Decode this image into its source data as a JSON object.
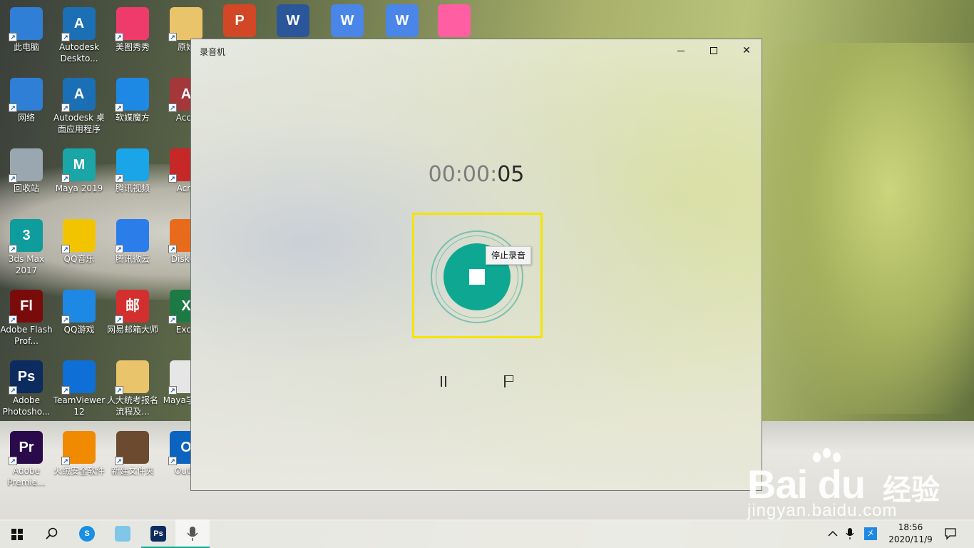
{
  "desktop": {
    "icons": [
      {
        "label": "此电脑",
        "glyph": "",
        "color": "#2f7fd6"
      },
      {
        "label": "Autodesk Deskto...",
        "glyph": "A",
        "color": "#1b6fb5"
      },
      {
        "label": "美图秀秀",
        "glyph": "",
        "color": "#ef3b6b"
      },
      {
        "label": "原始",
        "glyph": "",
        "color": "#e9c46a"
      },
      {
        "label": "网络",
        "glyph": "",
        "color": "#2f7fd6"
      },
      {
        "label": "Autodesk 桌面应用程序",
        "glyph": "A",
        "color": "#1b6fb5"
      },
      {
        "label": "软媒魔方",
        "glyph": "",
        "color": "#1e88e5"
      },
      {
        "label": "Acce",
        "glyph": "A",
        "color": "#a4373a"
      },
      {
        "label": "回收站",
        "glyph": "",
        "color": "#9aa7b0"
      },
      {
        "label": "Maya 2019",
        "glyph": "M",
        "color": "#1aa6a6"
      },
      {
        "label": "腾讯视频",
        "glyph": "",
        "color": "#1aa5e8"
      },
      {
        "label": "Acro",
        "glyph": "",
        "color": "#c62828"
      },
      {
        "label": "3ds Max 2017",
        "glyph": "3",
        "color": "#0f9c9c"
      },
      {
        "label": "QQ音乐",
        "glyph": "",
        "color": "#f2c400"
      },
      {
        "label": "腾讯微云",
        "glyph": "",
        "color": "#2b7de9"
      },
      {
        "label": "DiskGe",
        "glyph": "",
        "color": "#e86b1c"
      },
      {
        "label": "Adobe Flash Prof...",
        "glyph": "Fl",
        "color": "#7a0b0b"
      },
      {
        "label": "QQ游戏",
        "glyph": "",
        "color": "#1e88e5"
      },
      {
        "label": "网易邮箱大师",
        "glyph": "邮",
        "color": "#d32f2f"
      },
      {
        "label": "Exce",
        "glyph": "X",
        "color": "#1d7a45"
      },
      {
        "label": "Adobe Photosho...",
        "glyph": "Ps",
        "color": "#0c2b5e"
      },
      {
        "label": "TeamViewer 12",
        "glyph": "",
        "color": "#0e6fd6"
      },
      {
        "label": "人大统考报名流程及...",
        "glyph": "",
        "color": "#e9c46a"
      },
      {
        "label": "Maya学源.t",
        "glyph": "",
        "color": "#e6e6e6"
      },
      {
        "label": "Adobe Premie...",
        "glyph": "Pr",
        "color": "#2a0a4a"
      },
      {
        "label": "火绒安全软件",
        "glyph": "",
        "color": "#f08a00"
      },
      {
        "label": "新建文件夹",
        "glyph": "",
        "color": "#6b4a2f"
      },
      {
        "label": "Outlo",
        "glyph": "O",
        "color": "#0b64c0"
      }
    ],
    "top_row": [
      {
        "label": "",
        "glyph": "P",
        "color": "#d24726"
      },
      {
        "label": "",
        "glyph": "W",
        "color": "#2b579a"
      },
      {
        "label": "",
        "glyph": "W",
        "color": "#4a86e8"
      },
      {
        "label": "",
        "glyph": "W",
        "color": "#4a86e8"
      },
      {
        "label": "",
        "glyph": "",
        "color": "#ff5fa2"
      }
    ]
  },
  "window": {
    "title": "录音机",
    "min": "",
    "close": "✕"
  },
  "recorder": {
    "timer_dim": "00:00:",
    "timer_bright": "05",
    "tooltip": "停止录音"
  },
  "watermark": {
    "brand": "Bai du",
    "cn": "经验",
    "url": "jingyan.baidu.com"
  },
  "taskbar": {
    "ime": "㐅",
    "time": "18:56",
    "date": "2020/11/9",
    "colors": {
      "accent": "#0ea892"
    }
  }
}
